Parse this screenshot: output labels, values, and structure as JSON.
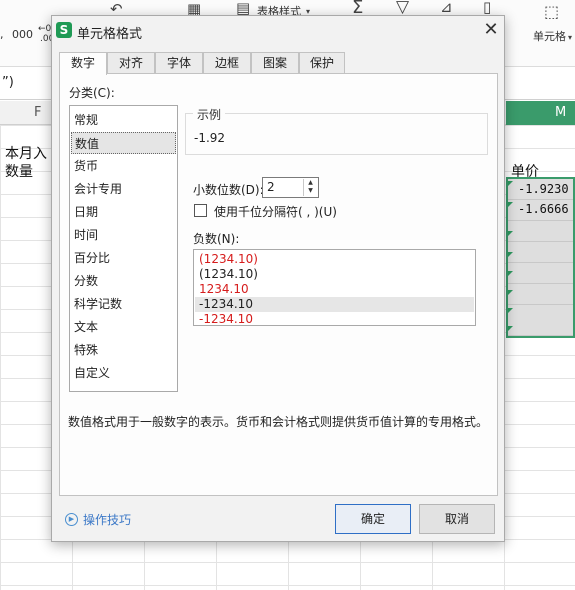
{
  "ribbon": {
    "number_format_marks": [
      ",",
      "000",
      "←0",
      ".00"
    ],
    "table_style_label": "表格样式",
    "cell_format_label": "单元格"
  },
  "formula_bar": {
    "content": "”)"
  },
  "sheet": {
    "col_f": "F",
    "col_m": "M",
    "header_line1": "本月入",
    "header_line2": "数量",
    "price_header": "单价",
    "m_values": [
      "-1.9230",
      "-1.6666"
    ],
    "accent_color": "#3a9b6b"
  },
  "dialog": {
    "title": "单元格格式",
    "tabs": [
      "数字",
      "对齐",
      "字体",
      "边框",
      "图案",
      "保护"
    ],
    "category_label": "分类(C):",
    "categories": [
      "常规",
      "数值",
      "货币",
      "会计专用",
      "日期",
      "时间",
      "百分比",
      "分数",
      "科学记数",
      "文本",
      "特殊",
      "自定义"
    ],
    "selected_category": "数值",
    "sample_label": "示例",
    "sample_value": "-1.92",
    "decimal_label": "小数位数(D):",
    "decimal_value": "2",
    "thousands_label": "使用千位分隔符( , )(U)",
    "thousands_checked": false,
    "negative_label": "负数(N):",
    "negatives": [
      {
        "text": "(1234.10)",
        "color": "red"
      },
      {
        "text": "(1234.10)",
        "color": "black"
      },
      {
        "text": "1234.10",
        "color": "red"
      },
      {
        "text": "-1234.10",
        "color": "black",
        "selected": true
      },
      {
        "text": "-1234.10",
        "color": "red"
      }
    ],
    "description": "数值格式用于一般数字的表示。货币和会计格式则提供货币值计算的专用格式。",
    "tips_label": "操作技巧",
    "ok_label": "确定",
    "cancel_label": "取消"
  }
}
